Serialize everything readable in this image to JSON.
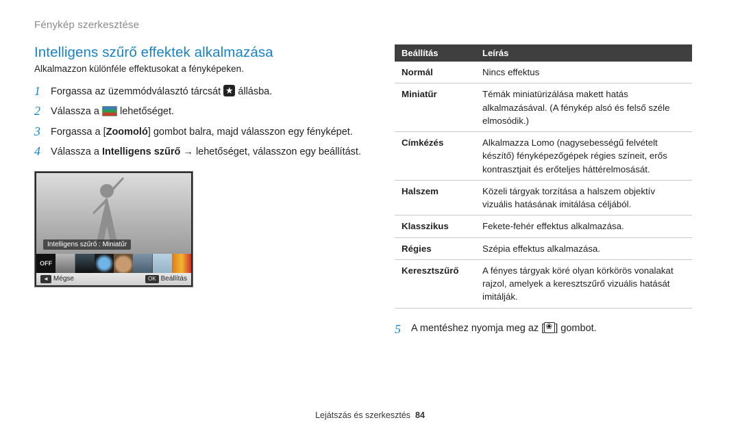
{
  "breadcrumb": "Fénykép szerkesztése",
  "section": {
    "title": "Intelligens szűrő effektek alkalmazása",
    "subtitle": "Alkalmazzon különféle effektusokat a fényképeken."
  },
  "steps": {
    "s1_a": "Forgassa az üzemmódválasztó tárcsát ",
    "s1_b": " állásba.",
    "s2_a": "Válassza a ",
    "s2_b": " lehetőséget.",
    "s3_a": "Forgassa a [",
    "s3_bold": "Zoomoló",
    "s3_b": "] gombot balra, majd válasszon egy fényképet.",
    "s4_a": "Válassza a ",
    "s4_bold": "Intelligens szűrő",
    "s4_arrow": " → ",
    "s4_b": "lehetőséget, válasszon egy beállítást.",
    "s5_a": "A mentéshez nyomja meg az [",
    "s5_b": "] gombot."
  },
  "preview": {
    "caption": "Intelligens szűrő : Miniatűr",
    "off_label": "OFF",
    "bar_back_key": "◄",
    "bar_back": "Mégse",
    "bar_ok_key": "OK",
    "bar_ok": "Beállítás"
  },
  "table": {
    "head_option": "Beállítás",
    "head_desc": "Leírás",
    "rows": [
      {
        "k": "Normál",
        "v": "Nincs effektus"
      },
      {
        "k": "Miniatűr",
        "v": "Témák miniatürizálása makett hatás alkalmazásával. (A fénykép alsó és felső széle elmosódik.)"
      },
      {
        "k": "Címkézés",
        "v": "Alkalmazza Lomo (nagysebességű felvételt készítő) fényképezőgépek régies színeit, erős kontrasztjait és erőteljes háttérelmosását."
      },
      {
        "k": "Halszem",
        "v": "Közeli tárgyak torzítása a halszem objektív vizuális hatásának imitálása céljából."
      },
      {
        "k": "Klasszikus",
        "v": "Fekete-fehér effektus alkalmazása."
      },
      {
        "k": "Régies",
        "v": "Szépia effektus alkalmazása."
      },
      {
        "k": "Keresztszűrő",
        "v": "A fényes tárgyak köré olyan körkörös vonalakat rajzol, amelyek a keresztszűrő vizuális hatását imitálják."
      }
    ]
  },
  "footer": {
    "section_label": "Lejátszás és szerkesztés",
    "page": "84"
  }
}
